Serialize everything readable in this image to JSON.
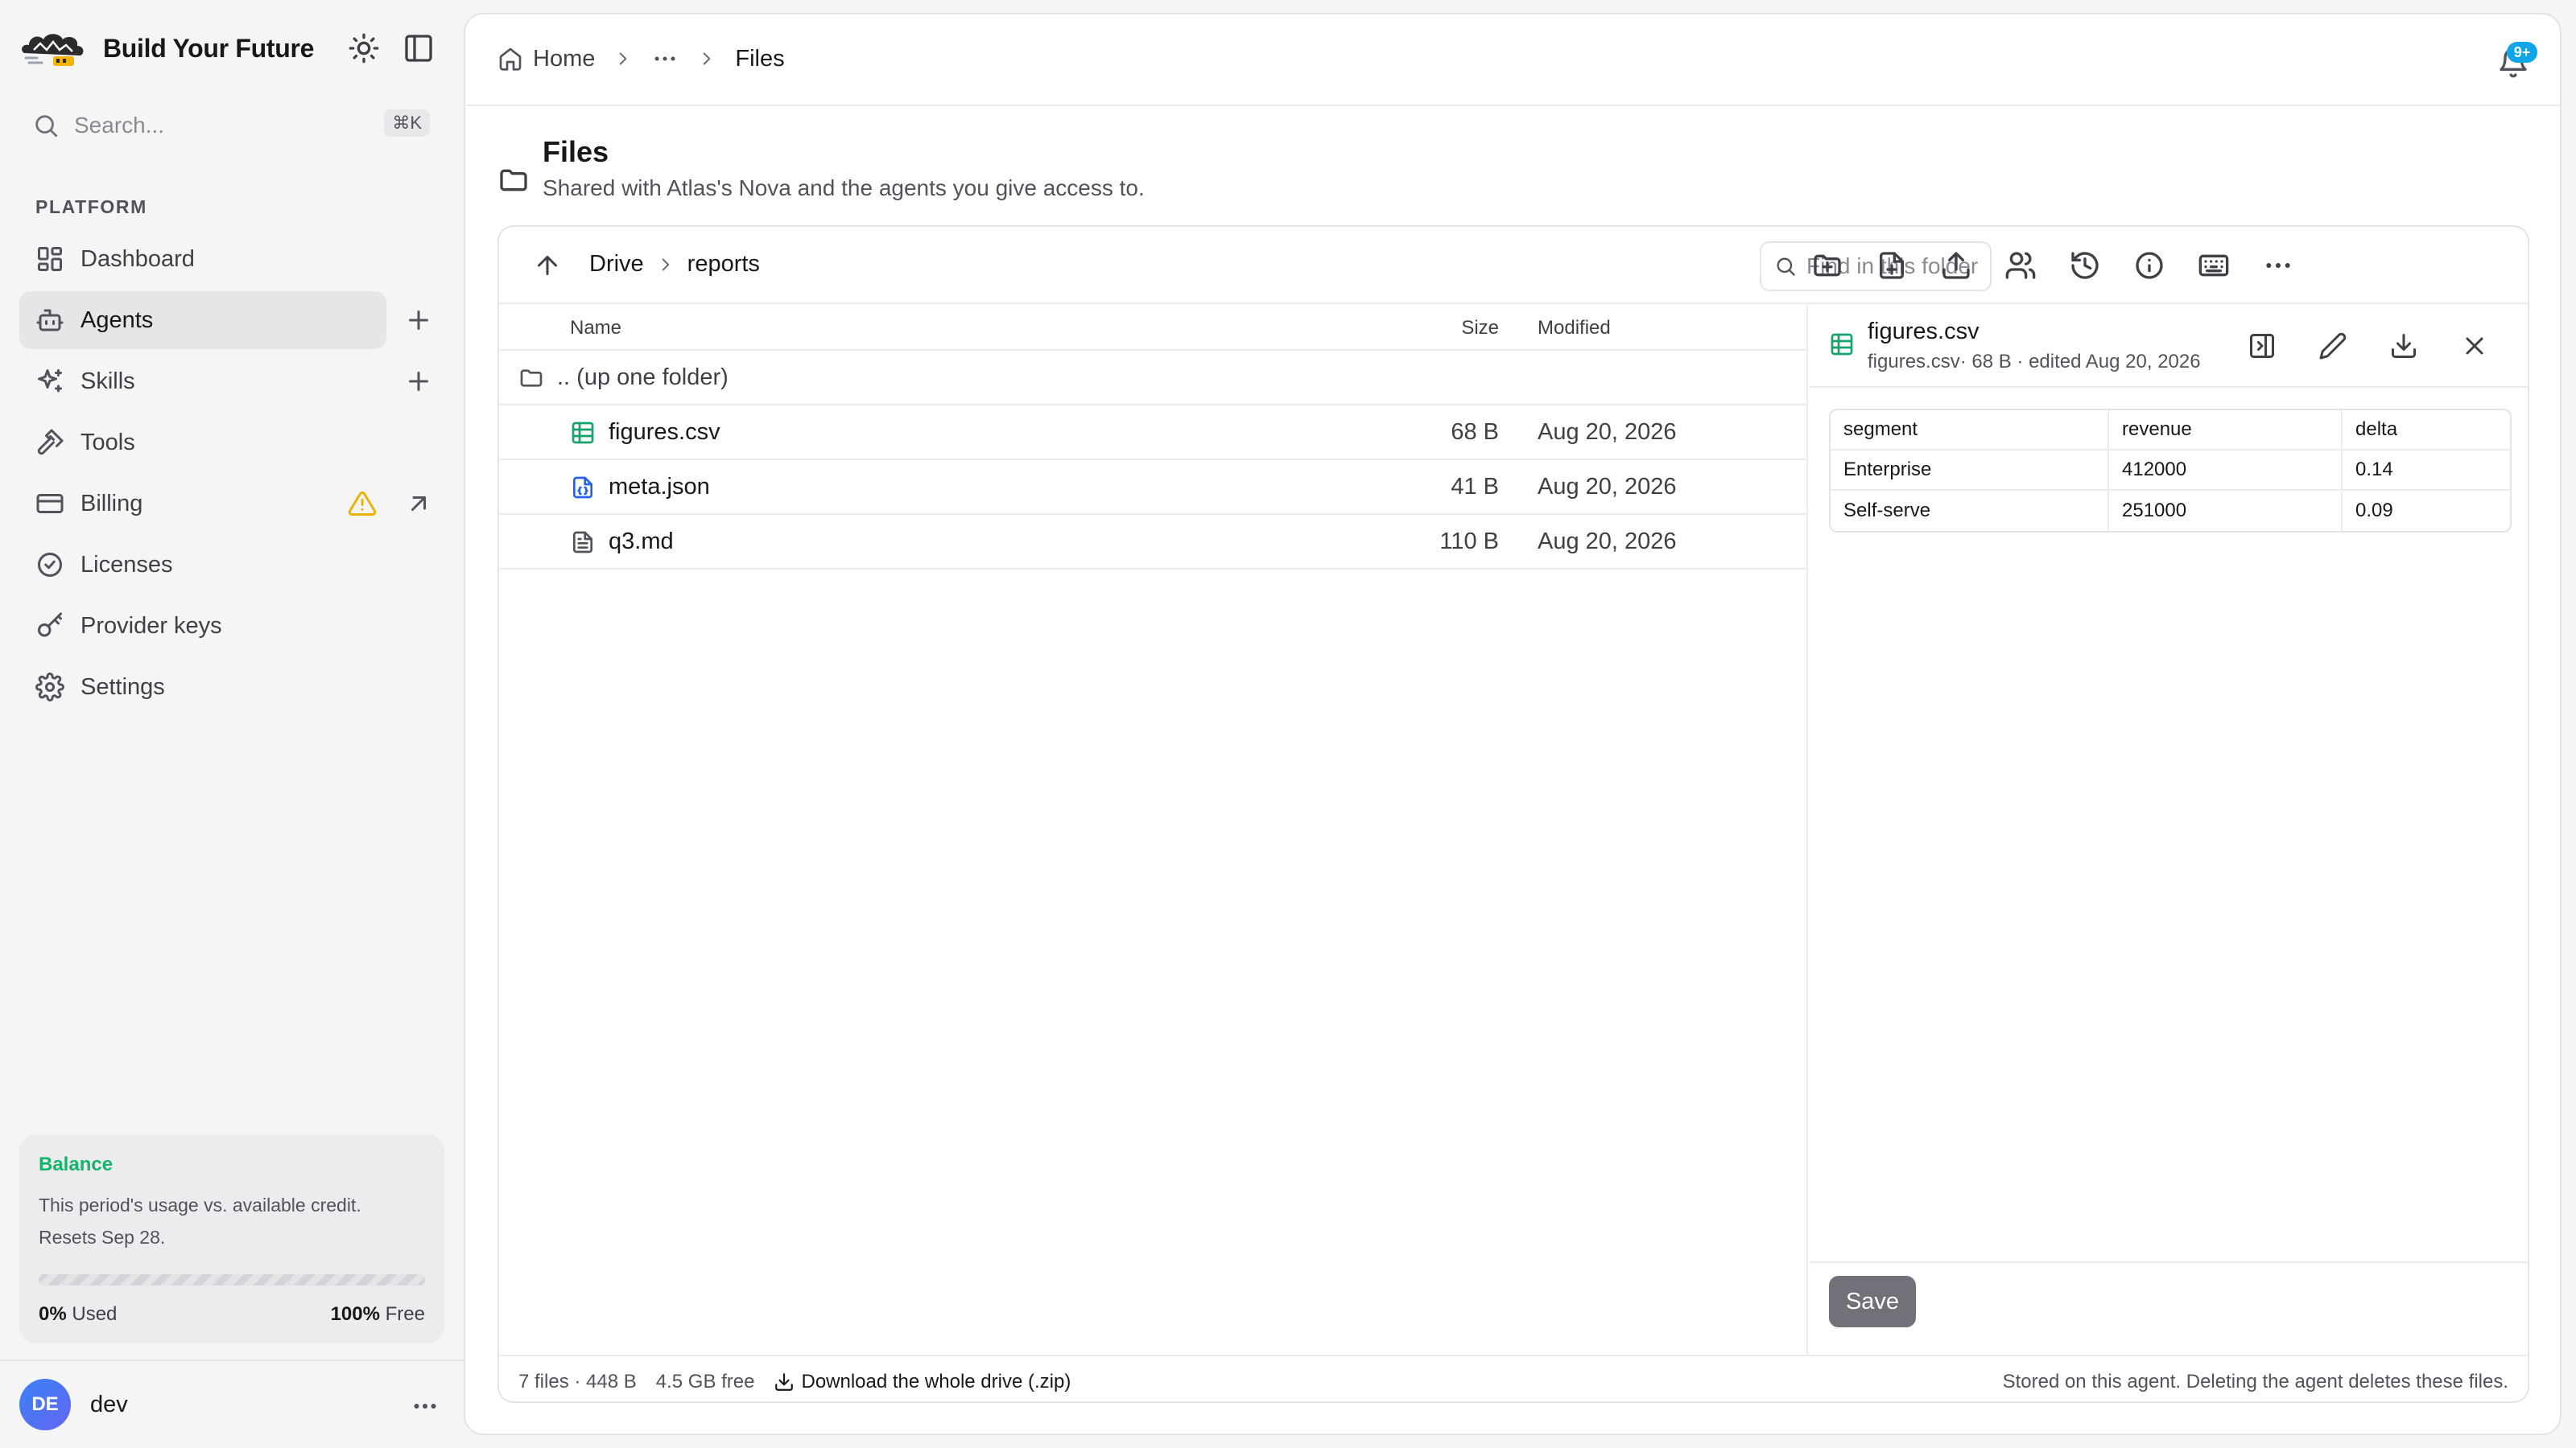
{
  "sidebar": {
    "brand": "Build Your Future",
    "search_placeholder": "Search...",
    "search_shortcut": "⌘K",
    "section_label": "PLATFORM",
    "items": [
      {
        "label": "Dashboard",
        "icon": "dashboard-icon"
      },
      {
        "label": "Agents",
        "icon": "bot-icon",
        "active": true
      },
      {
        "label": "Skills",
        "icon": "sparkles-icon"
      },
      {
        "label": "Tools",
        "icon": "hammer-icon"
      },
      {
        "label": "Billing",
        "icon": "credit-card-icon"
      },
      {
        "label": "Licenses",
        "icon": "badge-check-icon"
      },
      {
        "label": "Provider keys",
        "icon": "key-icon"
      },
      {
        "label": "Settings",
        "icon": "gear-icon"
      }
    ],
    "balance": {
      "title": "Balance",
      "description": "This period's usage vs. available credit. Resets Sep 28.",
      "used_pct": "0%",
      "used_label": "Used",
      "free_pct": "100%",
      "free_label": "Free",
      "used_fraction": 0
    },
    "user": {
      "initials": "DE",
      "name": "dev"
    }
  },
  "header": {
    "breadcrumb": {
      "home": "Home",
      "current": "Files"
    },
    "notification_badge": "9+"
  },
  "page": {
    "title": "Files",
    "subtitle": "Shared with Atlas's Nova and the agents you give access to."
  },
  "browser": {
    "path": [
      "Drive",
      "reports"
    ],
    "find_placeholder": "Find in this folder",
    "columns": {
      "name": "Name",
      "size": "Size",
      "modified": "Modified"
    },
    "up_row": ".. (up one folder)",
    "files": [
      {
        "name": "figures.csv",
        "size": "68 B",
        "modified": "Aug 20, 2026",
        "icon": "spreadsheet-icon"
      },
      {
        "name": "meta.json",
        "size": "41 B",
        "modified": "Aug 20, 2026",
        "icon": "json-file-icon"
      },
      {
        "name": "q3.md",
        "size": "110 B",
        "modified": "Aug 20, 2026",
        "icon": "text-file-icon"
      }
    ],
    "preview": {
      "title": "figures.csv",
      "meta_name": "figures.csv",
      "meta_rest": "· 68 B · edited Aug 20, 2026",
      "headers": [
        "segment",
        "revenue",
        "delta"
      ],
      "rows": [
        [
          "Enterprise",
          "412000",
          "0.14"
        ],
        [
          "Self-serve",
          "251000",
          "0.09"
        ]
      ],
      "save_label": "Save"
    },
    "status": {
      "summary": "7 files · 448 B",
      "free": "4.5 GB free",
      "download": "Download the whole drive (.zip)",
      "note": "Stored on this agent. Deleting the agent deletes these files."
    }
  },
  "colors": {
    "accent_green": "#16b36b",
    "badge_blue": "#0ea5e9",
    "warning": "#eab308"
  }
}
